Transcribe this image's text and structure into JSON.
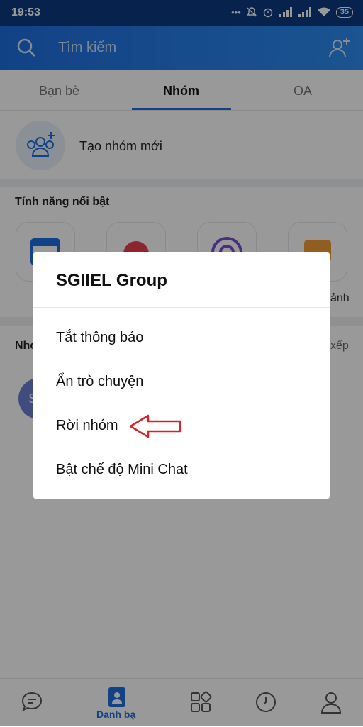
{
  "status_bar": {
    "time": "19:53",
    "battery": "35"
  },
  "header": {
    "search_placeholder": "Tìm kiếm"
  },
  "tabs": [
    {
      "label": "Bạn bè"
    },
    {
      "label": "Nhóm"
    },
    {
      "label": "OA"
    }
  ],
  "create_group": {
    "label": "Tạo nhóm mới"
  },
  "features": {
    "title": "Tính năng nổi bật",
    "partial_label": "ảnh"
  },
  "groups_section": {
    "title_partial": "Nhó",
    "sort_partial": "xếp",
    "avatar_initial": "S"
  },
  "bottom_nav": {
    "active_label": "Danh bạ"
  },
  "dialog": {
    "title": "SGIIEL Group",
    "options": [
      {
        "label": "Tắt thông báo"
      },
      {
        "label": "Ẩn trò chuyện"
      },
      {
        "label": "Rời nhóm"
      },
      {
        "label": "Bật chế độ Mini Chat"
      }
    ]
  },
  "colors": {
    "accent": "#1f6fe0",
    "annotation_arrow": "#d8232a"
  }
}
